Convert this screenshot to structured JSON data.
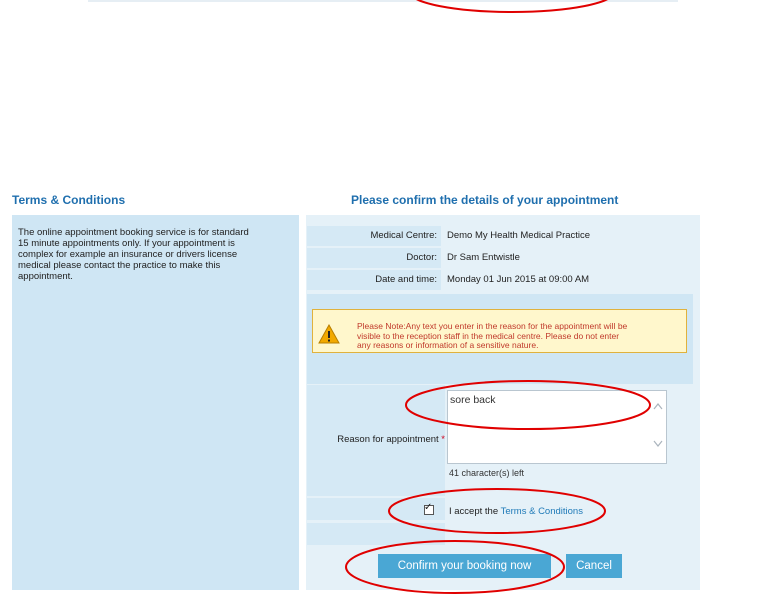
{
  "terms": {
    "heading": "Terms & Conditions",
    "lines": [
      "The online appointment booking service is for standard",
      "15 minute appointments only. If your appointment is",
      "complex for example an insurance or drivers license",
      "medical please contact the practice to make this",
      "appointment."
    ]
  },
  "confirm": {
    "heading": "Please confirm the details of your appointment",
    "details": [
      {
        "label": "Medical Centre:",
        "value": "Demo My Health Medical Practice"
      },
      {
        "label": "Doctor:",
        "value": "Dr Sam Entwistle"
      },
      {
        "label": "Date and time:",
        "value": "Monday 01 Jun 2015 at 09:00 AM"
      }
    ],
    "note_lines": [
      "Please Note:Any text you enter in the reason for the appointment will be",
      "visible to the reception staff in the medical centre. Please do not enter",
      "any reasons or information of a sensitive nature."
    ],
    "reason_label": "Reason for appointment",
    "reason_required": "*",
    "reason_value": "sore back",
    "chars_left": "41 character(s) left",
    "accept_prefix": "I accept the",
    "accept_link": "Terms & Conditions",
    "accept_checked": true,
    "confirm_button": "Confirm your booking now",
    "cancel_button": "Cancel"
  },
  "colors": {
    "heading": "#1f6fae",
    "annotation": "#e00000",
    "button": "#4aa7d4"
  }
}
